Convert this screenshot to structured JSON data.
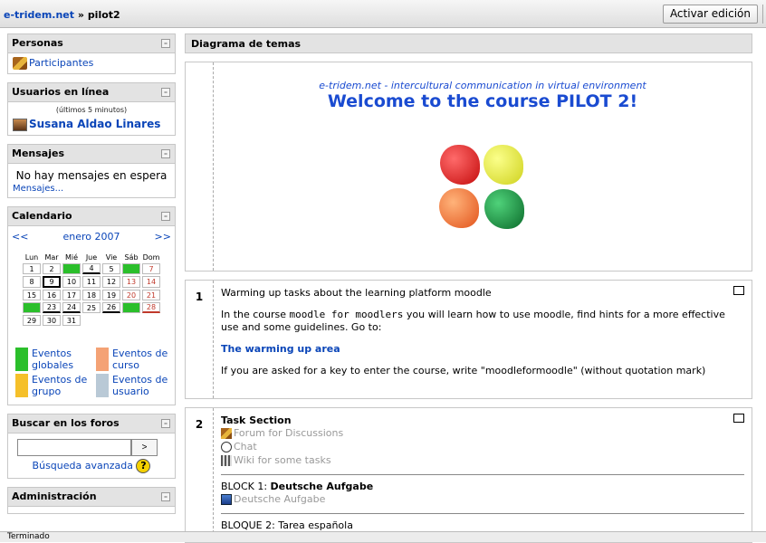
{
  "header": {
    "site": "e-tridem.net",
    "separator": "»",
    "course": "pilot2",
    "edit_button": "Activar edición"
  },
  "blocks": {
    "people": {
      "title": "Personas",
      "participants": "Participantes"
    },
    "online": {
      "title": "Usuarios en línea",
      "note": "(últimos 5 minutos)",
      "user": "Susana Aldao Linares"
    },
    "messages": {
      "title": "Mensajes",
      "none": "No hay mensajes en espera",
      "link": "Mensajes..."
    },
    "calendar": {
      "title": "Calendario",
      "prev": "<<",
      "month": "enero 2007",
      "next": ">>",
      "weekdays": [
        "Lun",
        "Mar",
        "Mié",
        "Jue",
        "Vie",
        "Sáb",
        "Dom"
      ],
      "weeks": [
        [
          "1",
          "2",
          "3",
          "4",
          "5",
          "6",
          "7"
        ],
        [
          "8",
          "9",
          "10",
          "11",
          "12",
          "13",
          "14"
        ],
        [
          "15",
          "16",
          "17",
          "18",
          "19",
          "20",
          "21"
        ],
        [
          "22",
          "23",
          "24",
          "25",
          "26",
          "27",
          "28"
        ],
        [
          "29",
          "30",
          "31",
          "",
          "",
          "",
          ""
        ]
      ],
      "legend": [
        "Eventos globales",
        "Eventos de curso",
        "Eventos de grupo",
        "Eventos de usuario"
      ],
      "legend_colors": [
        "#2bbf2b",
        "#f4a275",
        "#f5c02a",
        "#b9c9d6"
      ]
    },
    "search": {
      "title": "Buscar en los foros",
      "button": ">",
      "advanced": "Búsqueda avanzada",
      "help": "?"
    },
    "admin": {
      "title": "Administración"
    }
  },
  "main": {
    "topics_title": "Diagrama de temas",
    "section0": {
      "subtitle": "e-tridem.net - intercultural communication in virtual environment",
      "title": "Welcome to the course PILOT 2!"
    },
    "section1": {
      "num": "1",
      "intro": "Warming up tasks about the learning platform moodle",
      "p_before": "In the course ",
      "p_code": "moodle for moodlers",
      "p_after": " you will learn how to use moodle, find hints for a more effective use and some guidelines. Go to:",
      "link": "The warming up area",
      "key_note": "If you are asked for a key to enter the course, write \"moodleformoodle\" (without quotation mark)"
    },
    "section2": {
      "num": "2",
      "title": "Task Section",
      "activities": [
        "Forum for Discussions",
        "Chat",
        "Wiki for some tasks"
      ],
      "block1_prefix": "BLOCK 1: ",
      "block1_name": "Deutsche Aufgabe",
      "block1_item": "Deutsche Aufgabe",
      "block2_partial": "BLOQUE 2: Tarea española"
    }
  },
  "hide_glyph": "–",
  "status": "Terminado"
}
